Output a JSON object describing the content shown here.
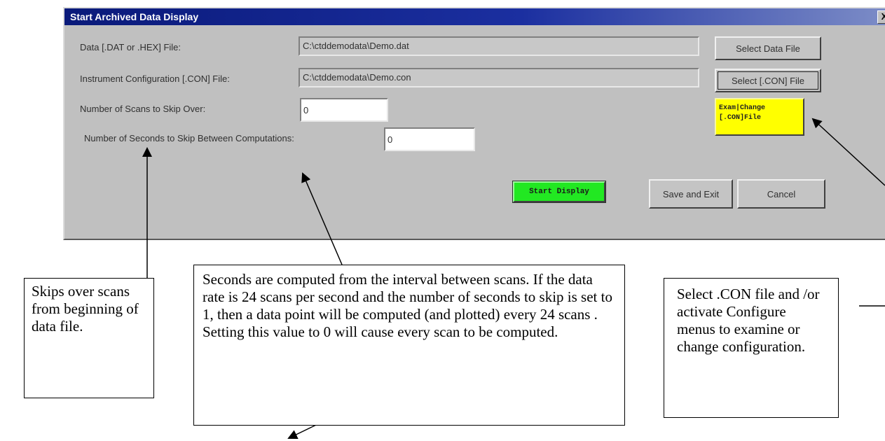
{
  "dialog": {
    "title": "Start Archived Data Display",
    "close_label": "X",
    "data_file_label": "Data [.DAT or .HEX] File:",
    "data_file_value": "C:\\ctddemodata\\Demo.dat",
    "select_data_file_button": "Select Data File",
    "con_file_label": "Instrument Configuration [.CON] File:",
    "con_file_value": "C:\\ctddemodata\\Demo.con",
    "select_con_file_button": "Select [.CON] File",
    "scans_skip_label": "Number of Scans to Skip Over:",
    "scans_skip_value": "0",
    "seconds_skip_label": "Number of Seconds to Skip Between Computations:",
    "seconds_skip_value": "0",
    "exam_change_button_line1": "Exam|Change",
    "exam_change_button_line2": "[.CON]File",
    "start_display_button": "Start Display",
    "save_exit_button": "Save and Exit",
    "cancel_button": "Cancel"
  },
  "annotations": {
    "scans_callout": "Skips over scans from beginning of data file.",
    "seconds_callout": "Seconds are computed from the interval between scans. If the data rate is 24 scans per second and the number of seconds to skip is set to 1, then a data point will be computed (and plotted) every 24 scans . Setting this value to 0 will cause every scan to be computed.",
    "con_callout": "Select .CON file and /or activate Configure menus to examine or change configuration."
  },
  "colors": {
    "titlebar": "#0a1a7a",
    "dialog_bg": "#c0c0c0",
    "exam_button": "#ffff00",
    "start_button": "#22e822"
  }
}
